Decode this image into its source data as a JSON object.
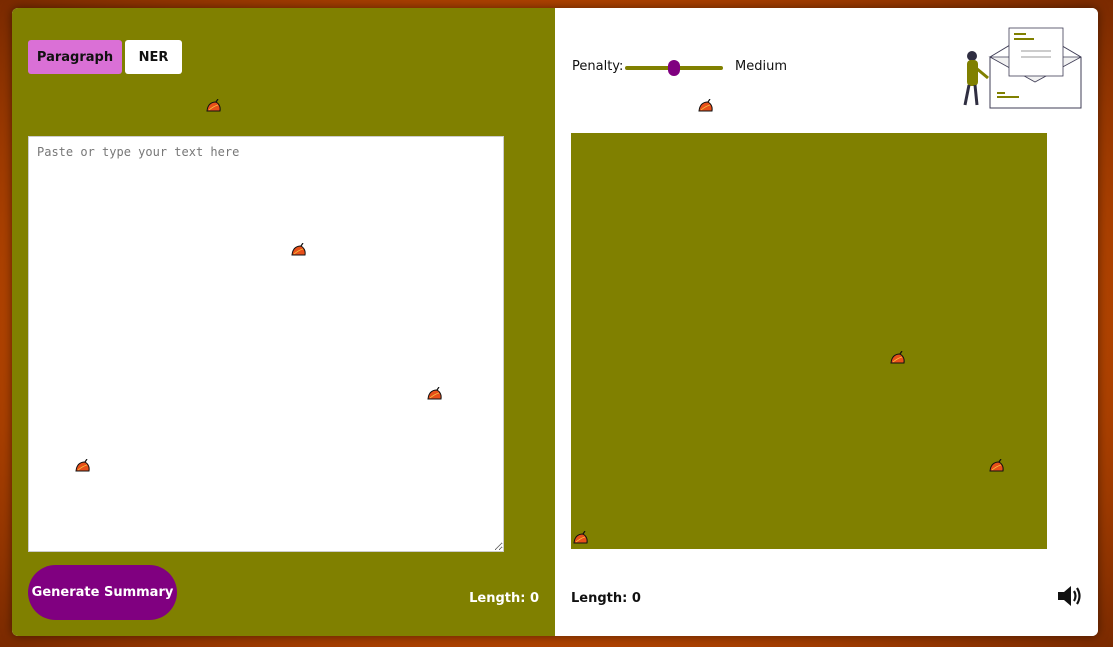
{
  "tabs": {
    "paragraph_label": "Paragraph",
    "ner_label": "NER"
  },
  "input": {
    "placeholder": "Paste or type your text here",
    "value": ""
  },
  "actions": {
    "generate_label": "Generate Summary"
  },
  "left_panel": {
    "length_text": "Length: 0"
  },
  "penalty": {
    "label": "Penalty:",
    "value_text": "Medium",
    "level": 0.5
  },
  "right_panel": {
    "length_text": "Length: 0"
  },
  "icons": {
    "speaker": "speaker-icon",
    "leaf": "autumn-leaf-icon",
    "illustration": "person-with-envelope-illustration"
  },
  "colors": {
    "olive": "#808000",
    "purple": "#800080",
    "orchid": "#da70d6",
    "white": "#ffffff",
    "border_glow": "#d35400"
  }
}
